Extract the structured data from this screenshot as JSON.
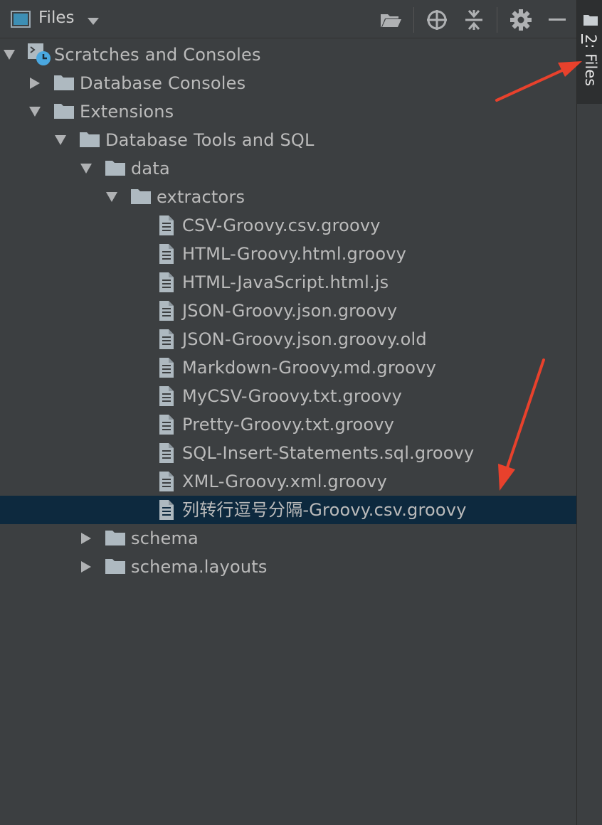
{
  "header": {
    "title": "Files"
  },
  "toolbar": {
    "icons": [
      "open-folder-icon",
      "locate-icon",
      "collapse-all-icon",
      "gear-icon",
      "minimize-icon"
    ]
  },
  "sidebar": {
    "tab_number": "2",
    "tab_label": ": Files"
  },
  "tree": {
    "root": "Scratches and Consoles",
    "database_consoles": "Database Consoles",
    "extensions": "Extensions",
    "db_tools": "Database Tools and SQL",
    "data": "data",
    "extractors": "extractors",
    "files": [
      "CSV-Groovy.csv.groovy",
      "HTML-Groovy.html.groovy",
      "HTML-JavaScript.html.js",
      "JSON-Groovy.json.groovy",
      "JSON-Groovy.json.groovy.old",
      "Markdown-Groovy.md.groovy",
      "MyCSV-Groovy.txt.groovy",
      "Pretty-Groovy.txt.groovy",
      "SQL-Insert-Statements.sql.groovy",
      "XML-Groovy.xml.groovy",
      "列转行逗号分隔-Groovy.csv.groovy"
    ],
    "schema": "schema",
    "schema_layouts": "schema.layouts"
  },
  "colors": {
    "background": "#3c3f41",
    "selection": "#0d293e",
    "text": "#bbbbbb",
    "folder": "#aeb9c0",
    "annotation_arrow": "#e8412c"
  }
}
